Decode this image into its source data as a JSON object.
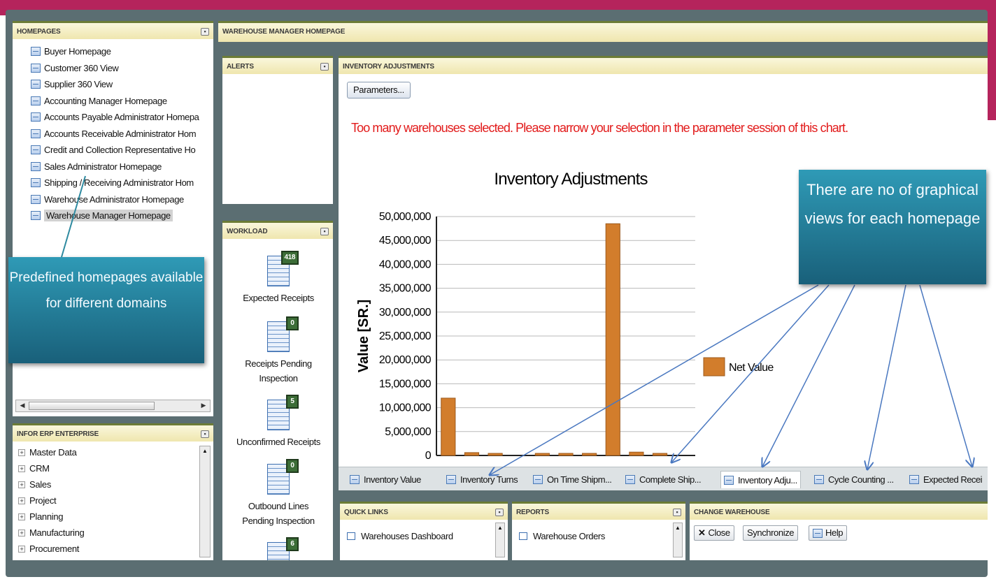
{
  "homepages": {
    "title": "HOMEPAGES",
    "items": [
      {
        "label": "Buyer Homepage"
      },
      {
        "label": "Customer 360 View"
      },
      {
        "label": "Supplier 360 View"
      },
      {
        "label": "Accounting Manager Homepage"
      },
      {
        "label": "Accounts Payable Administrator Homepa"
      },
      {
        "label": "Accounts Receivable Administrator Hom"
      },
      {
        "label": "Credit and Collection Representative Ho"
      },
      {
        "label": "Sales Administrator Homepage"
      },
      {
        "label": "Shipping / Receiving Administrator Hom"
      },
      {
        "label": "Warehouse Administrator Homepage"
      },
      {
        "label": "Warehouse Manager Homepage"
      }
    ]
  },
  "erp": {
    "title": "INFOR ERP ENTERPRISE",
    "items": [
      {
        "label": "Master Data"
      },
      {
        "label": "CRM"
      },
      {
        "label": "Sales"
      },
      {
        "label": "Project"
      },
      {
        "label": "Planning"
      },
      {
        "label": "Manufacturing"
      },
      {
        "label": "Procurement"
      }
    ]
  },
  "main": {
    "title": "WAREHOUSE MANAGER HOMEPAGE"
  },
  "alerts": {
    "title": "ALERTS"
  },
  "workload": {
    "title": "WORKLOAD",
    "items": [
      {
        "label": "Expected Receipts",
        "badge": "418"
      },
      {
        "label": "Receipts Pending Inspection",
        "badge": "0"
      },
      {
        "label": "Unconfirmed Receipts",
        "badge": "5"
      },
      {
        "label": "Outbound Lines Pending Inspection",
        "badge": "0"
      },
      {
        "label": "",
        "badge": "6"
      }
    ]
  },
  "inventory": {
    "title": "INVENTORY ADJUSTMENTS",
    "params_button": "Parameters...",
    "warning": "Too many warehouses selected. Please narrow your selection in the parameter session of this chart."
  },
  "chart_data": {
    "type": "bar",
    "title": "Inventory Adjustments",
    "ylabel": "Value [SR.]",
    "xlabel": "",
    "ylim": [
      0,
      50000000
    ],
    "yticks": [
      0,
      5000000,
      10000000,
      15000000,
      20000000,
      25000000,
      30000000,
      35000000,
      40000000,
      45000000,
      50000000
    ],
    "ytick_labels": [
      "0",
      "5,000,000",
      "10,000,000",
      "15,000,000",
      "20,000,000",
      "25,000,000",
      "30,000,000",
      "35,000,000",
      "40,000,000",
      "45,000,000",
      "50,000,000"
    ],
    "categories": [
      "",
      "",
      "",
      "",
      "",
      "",
      "",
      "",
      "",
      "",
      ""
    ],
    "series": [
      {
        "name": "Net Value",
        "color": "#d27d2c",
        "values": [
          12000000,
          600000,
          400000,
          0,
          400000,
          400000,
          400000,
          48500000,
          700000,
          150000,
          0
        ]
      }
    ],
    "legend": "right",
    "grid": true
  },
  "tabs": [
    {
      "label": "Inventory Value"
    },
    {
      "label": "Inventory Turns"
    },
    {
      "label": "On Time Shipm..."
    },
    {
      "label": "Complete Ship..."
    },
    {
      "label": "Inventory Adju..."
    },
    {
      "label": "Cycle Counting ..."
    },
    {
      "label": "Expected Recei"
    }
  ],
  "quick_links": {
    "title": "QUICK LINKS",
    "item": "Warehouses Dashboard"
  },
  "reports": {
    "title": "REPORTS",
    "item": "Warehouse Orders"
  },
  "change_warehouse": {
    "title": "CHANGE WAREHOUSE",
    "close": "Close",
    "synchronize": "Synchronize",
    "help": "Help"
  },
  "callouts": {
    "left": "Predefined homepages available for different domains",
    "right": "There are no of graphical views for each homepage"
  },
  "colors": {
    "brand_band": "#b5245c",
    "callout": "#19607a",
    "bar": "#d27d2c",
    "warning": "#e21b1b"
  }
}
